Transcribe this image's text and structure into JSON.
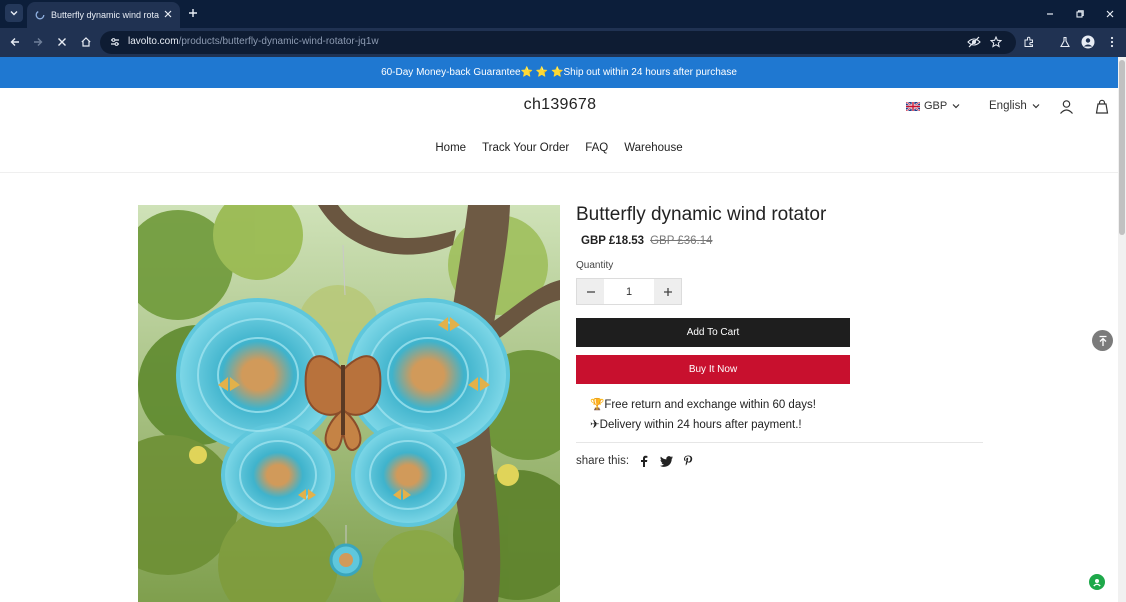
{
  "browser": {
    "tab_title": "Butterfly dynamic wind rotator",
    "url_host": "lavolto.com",
    "url_path": "/products/butterfly-dynamic-wind-rotator-jq1w"
  },
  "announcement": {
    "text": "60-Day Money-back Guarantee⭐ ⭐ ⭐Ship out within 24 hours after purchase",
    "background": "#1f78d1"
  },
  "header": {
    "brand": "ch139678",
    "currency": "GBP",
    "language": "English"
  },
  "nav": {
    "items": [
      {
        "label": "Home"
      },
      {
        "label": "Track Your Order"
      },
      {
        "label": "FAQ"
      },
      {
        "label": "Warehouse"
      }
    ]
  },
  "product": {
    "title": "Butterfly dynamic wind rotator",
    "price": "GBP £18.53",
    "compare_price": "GBP £36.14",
    "quantity_label": "Quantity",
    "quantity": "1",
    "add_to_cart": "Add To Cart",
    "buy_now": "Buy It Now",
    "perks": [
      "🏆Free return and exchange within 60 days!",
      "✈Delivery within 24 hours after payment.!"
    ],
    "share_label": "share this:",
    "colors": {
      "add_to_cart": "#1e1e1e",
      "buy_now": "#c8102e"
    }
  }
}
